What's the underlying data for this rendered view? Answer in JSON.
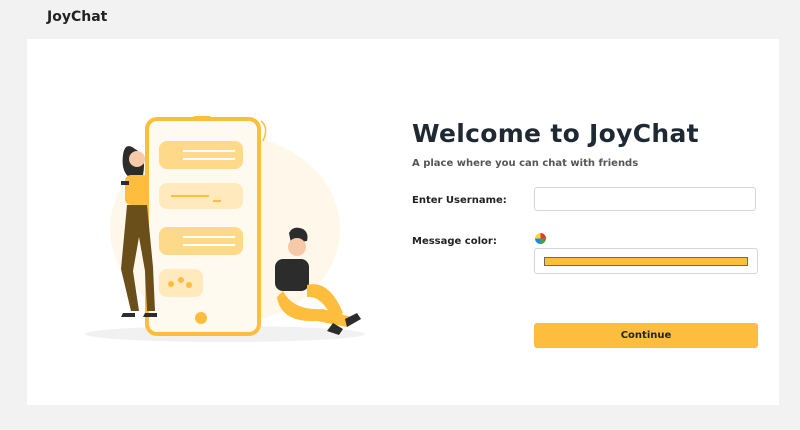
{
  "header": {
    "brand": "JoyChat"
  },
  "welcome": {
    "title": "Welcome to JoyChat",
    "subtitle": "A place where you can chat with friends"
  },
  "form": {
    "username_label": "Enter Username:",
    "username_value": "",
    "username_placeholder": "",
    "color_label": "Message color:",
    "color_value": "#ffbd3d",
    "continue_label": "Continue"
  },
  "colors": {
    "accent": "#ffbd3d",
    "background": "#f2f2f2",
    "card": "#ffffff"
  }
}
